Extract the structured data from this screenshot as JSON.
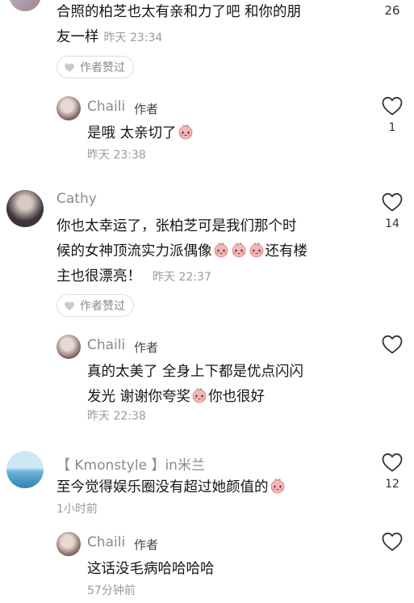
{
  "comments": [
    {
      "text_lines": [
        "合照的柏芝也太有亲和力了吧 和你的朋",
        "友一样"
      ],
      "time": "昨天 23:34",
      "likes": "26",
      "author_liked_label": "作者赞过",
      "reply": {
        "name": "Chaili",
        "author_tag": "作者",
        "text_parts": [
          "是哦 太亲切了"
        ],
        "emoji_count": 1,
        "time": "昨天 23:38",
        "likes": "1"
      }
    },
    {
      "name": "Cathy",
      "text_lines": [
        "你也太幸运了，张柏芝可是我们那个时",
        "候的女神顶流实力派偶像",
        "还有楼",
        "主也很漂亮！"
      ],
      "time": "昨天 22:37",
      "likes": "14",
      "author_liked_label": "作者赞过",
      "reply": {
        "name": "Chaili",
        "author_tag": "作者",
        "text_lines": [
          "真的太美了 全身上下都是优点闪闪",
          "发光 谢谢你夸奖",
          "你也很好"
        ],
        "time": "昨天 22:38"
      }
    },
    {
      "name": "【 Kmonstyle 】in米兰",
      "text": "至今觉得娱乐圈没有超过她颜值的",
      "time": "1小时前",
      "likes": "12",
      "reply": {
        "name": "Chaili",
        "author_tag": "作者",
        "text": "这话没毛病哈哈哈哈",
        "time": "57分钟前"
      }
    }
  ],
  "icons": {
    "heart": "heart-outline-icon",
    "small_heart": "heart-filled-icon",
    "emoji": "peach-face-emoji"
  },
  "colors": {
    "text": "#151515",
    "meta": "#9a9a9a",
    "border": "#dcdcdc"
  }
}
